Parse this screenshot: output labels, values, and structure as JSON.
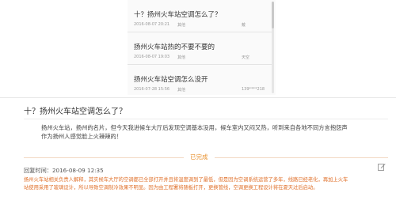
{
  "questions_list": [
    {
      "title": "十？扬州火车站空调怎么了？",
      "date": "2016-08-07 20:21",
      "category": "其他",
      "user": "戴"
    },
    {
      "title": "扬州火车站热的不要不要的",
      "date": "2016-08-07 19:03",
      "category": "其他",
      "user": "天空"
    },
    {
      "title": "扬州火车站空调怎么没开",
      "date": "2016-07-28 15:56",
      "category": "其他",
      "user": "139****218"
    }
  ],
  "detail": {
    "title": "十？扬州火车站空调怎么了？",
    "body_lines": [
      "扬州火车站，扬州的名片，但今天我进候车大厅后发现空调基本没用，候车室内又闷又热，听到来自各地不同方言抱怨声",
      "作为扬州人感觉脸上火辣辣的！"
    ],
    "status": "已完成",
    "reply_time": "回复时间：2016-08-09 12:35",
    "reply_lines": [
      "扬州火车站相关负责人解释，其实候车大厅的空调都已全部打开并且将温度调到了最低，但是因为空调系统运营了多年，线路已经老化，再加上火车",
      "站使用采用了玻璃设计，所以导致空调制冷效果不明显。因为由工程署将随板打开，更换管线，空调更换工程设计将在夏天过后启动。"
    ]
  },
  "icons": {
    "edit": "edit-icon"
  },
  "colors": {
    "status_accent": "#e8912f",
    "reply_text": "#e0702a"
  }
}
